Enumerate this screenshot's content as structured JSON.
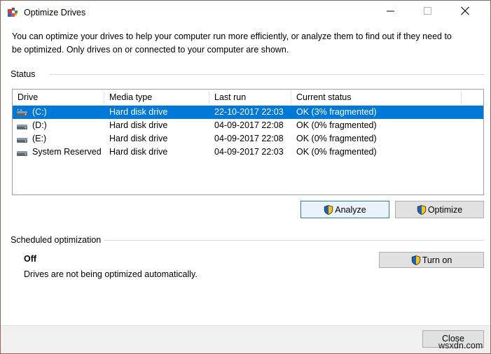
{
  "window": {
    "title": "Optimize Drives",
    "icon": "defrag-icon",
    "controls": {
      "minimize": "minimize-icon",
      "maximize": "maximize-icon",
      "close": "close-icon"
    }
  },
  "description": "You can optimize your drives to help your computer run more efficiently, or analyze them to find out if they need to be optimized. Only drives on or connected to your computer are shown.",
  "status_section": {
    "label": "Status",
    "columns": [
      "Drive",
      "Media type",
      "Last run",
      "Current status"
    ],
    "rows": [
      {
        "drive": "(C:)",
        "media_type": "Hard disk drive",
        "last_run": "22-10-2017 22:03",
        "current_status": "OK (3% fragmented)",
        "selected": true,
        "icon": "system-drive-icon"
      },
      {
        "drive": "(D:)",
        "media_type": "Hard disk drive",
        "last_run": "04-09-2017 22:08",
        "current_status": "OK (0% fragmented)",
        "selected": false,
        "icon": "drive-icon"
      },
      {
        "drive": "(E:)",
        "media_type": "Hard disk drive",
        "last_run": "04-09-2017 22:08",
        "current_status": "OK (0% fragmented)",
        "selected": false,
        "icon": "drive-icon"
      },
      {
        "drive": "System Reserved",
        "media_type": "Hard disk drive",
        "last_run": "04-09-2017 22:03",
        "current_status": "OK (0% fragmented)",
        "selected": false,
        "icon": "drive-icon"
      }
    ],
    "buttons": {
      "analyze": "Analyze",
      "optimize": "Optimize"
    }
  },
  "scheduled_section": {
    "label": "Scheduled optimization",
    "state": "Off",
    "detail": "Drives are not being optimized automatically.",
    "turn_on_button": "Turn on"
  },
  "footer": {
    "close_button": "Close",
    "watermark": "wsxdn.com"
  },
  "colors": {
    "selection": "#0078d7",
    "window_border": "#9e5f57",
    "focus_border": "#1a7ec2",
    "button_face": "#e1e1e1",
    "bottom_bar": "#f0f0f0"
  }
}
